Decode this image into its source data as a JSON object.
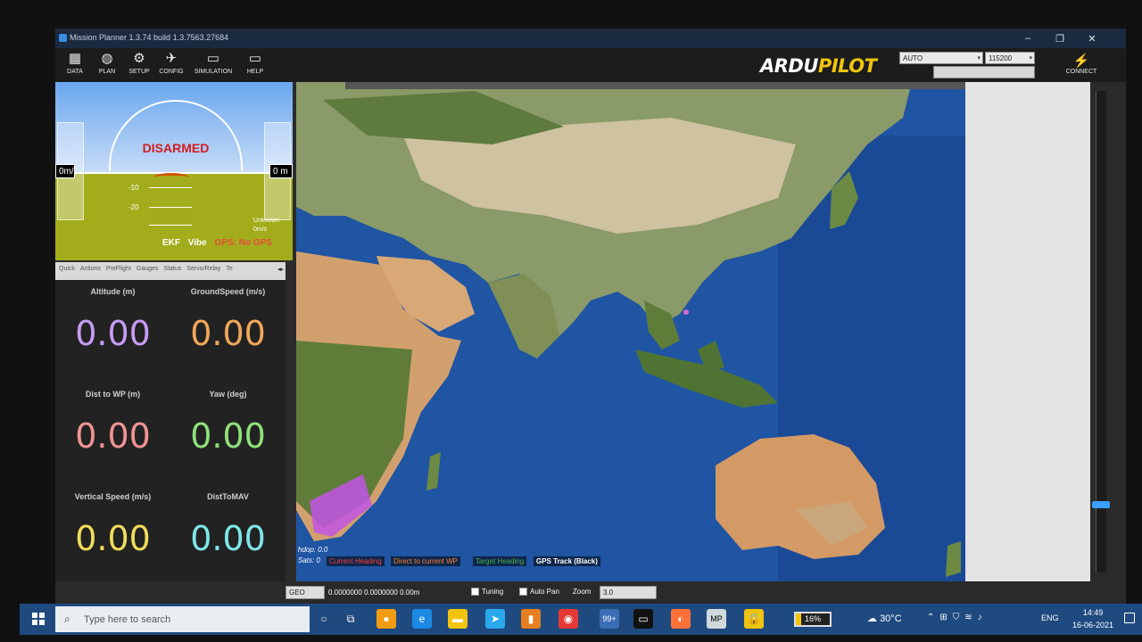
{
  "window": {
    "title": "Mission Planner 1.3.74 build 1.3.7563.27684",
    "controls": [
      "–",
      "❐",
      "✕"
    ]
  },
  "menu": [
    {
      "label": "DATA",
      "icon": "data-icon"
    },
    {
      "label": "PLAN",
      "icon": "globe-icon"
    },
    {
      "label": "SETUP",
      "icon": "gears-icon"
    },
    {
      "label": "CONFIG",
      "icon": "wrench-icon"
    },
    {
      "label": "SIMULATION",
      "icon": "monitor-icon"
    },
    {
      "label": "HELP",
      "icon": "help-icon"
    }
  ],
  "logo": {
    "ardu": "ARDU",
    "pilot": "PILOT"
  },
  "mode_combo": "AUTO",
  "baud_combo": "115200",
  "connect_label": "CONNECT",
  "hud": {
    "status": "DISARMED",
    "left_box": "0m/",
    "right_box": "0 m",
    "ladder": [
      "-10",
      "-20"
    ],
    "alt_text": "Unknown",
    "alt_sub": "0m/s",
    "ekf": "EKF",
    "vibe": "Vibe",
    "gps": "GPS: No GPS"
  },
  "tabs": [
    "Quick",
    "Actions",
    "PreFlight",
    "Gauges",
    "Status",
    "Servo/Relay",
    "Te"
  ],
  "quick": [
    {
      "label": "Altitude (m)",
      "value": "0.00",
      "color": "#c79cf5"
    },
    {
      "label": "GroundSpeed (m/s)",
      "value": "0.00",
      "color": "#f0a85a"
    },
    {
      "label": "Dist to WP (m)",
      "value": "0.00",
      "color": "#f29393"
    },
    {
      "label": "Yaw (deg)",
      "value": "0.00",
      "color": "#8fe07a"
    },
    {
      "label": "Vertical Speed (m/s)",
      "value": "0.00",
      "color": "#f0dc5a"
    },
    {
      "label": "DistToMAV",
      "value": "0.00",
      "color": "#7fe6ea"
    }
  ],
  "map": {
    "hdop": "hdop: 0.0",
    "sats": "Sats: 0",
    "legend": [
      {
        "label": "Current Heading",
        "color": "#ff3b3b"
      },
      {
        "label": "Direct to current WP",
        "color": "#ff7f2a"
      },
      {
        "label": "Target Heading",
        "color": "#4caf50"
      },
      {
        "label": "GPS Track (Black)",
        "color": "#ffffff"
      }
    ]
  },
  "bottom": {
    "coord_system": "GEO",
    "coords": "0.0000000 0.0000000  0.00m",
    "tuning": "Tuning",
    "autopan": "Auto Pan",
    "zoom_label": "Zoom",
    "zoom_value": "3.0"
  },
  "taskbar": {
    "search_placeholder": "Type here to search",
    "battery": "16%",
    "battery_level": 0.16,
    "temperature": "30°C",
    "lang": "ENG",
    "time": "14:49",
    "date": "16-06-2021",
    "badge": "99+"
  }
}
